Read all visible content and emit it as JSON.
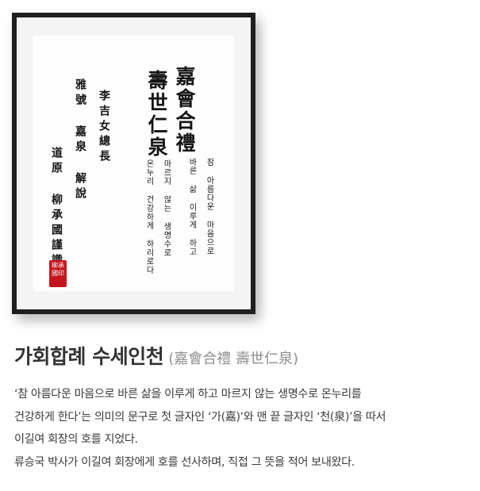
{
  "artwork": {
    "col_title_1": "嘉會合禮",
    "col_title_2": "壽世仁泉",
    "col_hangul_1": "참 아름다운 마음으로",
    "col_hangul_2": "바른 삶 이루게 하고",
    "col_hangul_3": "마르지 않는 생명수로",
    "col_hangul_4": "온누리 건강하게 하리로다",
    "col_recipient": "李吉女總長",
    "col_explain": "雅號 嘉泉 解說",
    "col_author": "道原 柳承國謹識",
    "seal_text": "柳承國印"
  },
  "heading": {
    "title": "가회합례 수세인천",
    "subtitle": "(嘉會合禮 壽世仁泉)"
  },
  "description": {
    "line_1": "‘참 아름다운 마음으로 바른 삶을 이루게 하고 마르지 않는 생명수로 온누리를",
    "line_2": "건강하게 한다’는 의미의 문구로 첫 글자인 ‘가(嘉)’와 맨 끝 글자인 ‘천(泉)’을 따서",
    "line_3": "이길여 회장의 호를 지었다.",
    "line_4": "류승국 박사가 이길여 회장에게 호를 선사하며, 직접 그 뜻을 적어 보내왔다."
  }
}
